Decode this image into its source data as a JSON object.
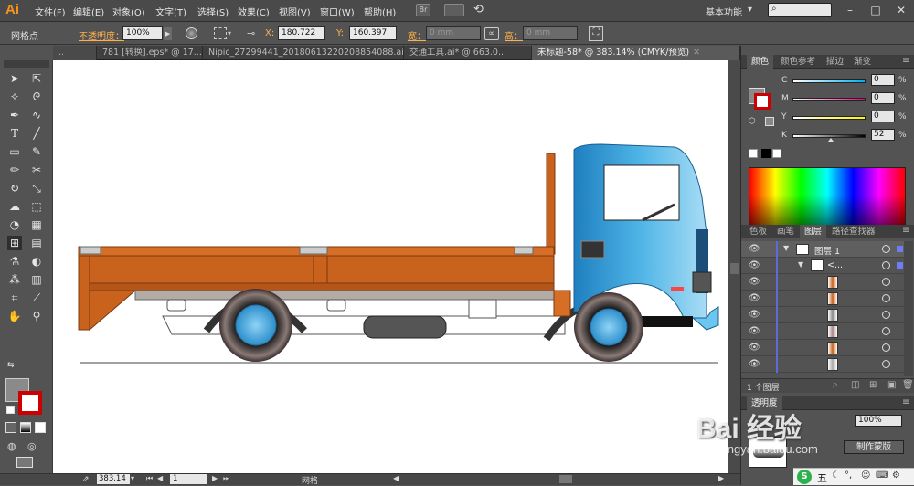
{
  "app": {
    "logo": "Ai"
  },
  "menu": [
    "文件(F)",
    "编辑(E)",
    "对象(O)",
    "文字(T)",
    "选择(S)",
    "效果(C)",
    "视图(V)",
    "窗口(W)",
    "帮助(H)"
  ],
  "topbar": {
    "br_label": "Br",
    "workspace": "基本功能"
  },
  "control": {
    "tool_name": "网格点",
    "opacity_label": "不透明度：",
    "opacity_value": "100%",
    "x_label": "X:",
    "x_value": "180.722",
    "y_label": "Y:",
    "y_value": "160.397",
    "w_label": "宽：",
    "w_value": "0 mm",
    "h_label": "高：",
    "h_value": "0 mm"
  },
  "doc_tabs": [
    {
      "label": "781 [转换].eps* @ 17..."
    },
    {
      "label": "Nipic_27299441_20180613220208854088.ai*"
    },
    {
      "label": "交通工具.ai* @ 663.0..."
    },
    {
      "label": "未标题-58* @ 383.14% (CMYK/预览)"
    }
  ],
  "color_panel": {
    "tabs": [
      "颜色",
      "颜色参考",
      "描边",
      "渐变"
    ],
    "channels": [
      {
        "label": "C",
        "value": "0",
        "unit": "%"
      },
      {
        "label": "M",
        "value": "0",
        "unit": "%"
      },
      {
        "label": "Y",
        "value": "0",
        "unit": "%"
      },
      {
        "label": "K",
        "value": "52",
        "unit": "%"
      }
    ],
    "k_level": 0.52
  },
  "layers_panel": {
    "tabs": [
      "色板",
      "画笔",
      "图层",
      "路径查找器"
    ],
    "layer_name": "图层 1",
    "group_name": "<...",
    "footer": "1 个图层"
  },
  "transparency_panel": {
    "tab": "透明度",
    "opacity": "100%",
    "make_mask": "制作蒙版"
  },
  "status": {
    "zoom": "383.14",
    "page": "1",
    "tool": "网格"
  },
  "watermark": {
    "brand": "Bai 经验",
    "url": "jingyan.baidu.com"
  },
  "tray": {
    "ime": "五"
  },
  "colors": {
    "truck_cab": "#3aa0d8",
    "truck_bed": "#c8621c",
    "accent": "#f7931e"
  }
}
